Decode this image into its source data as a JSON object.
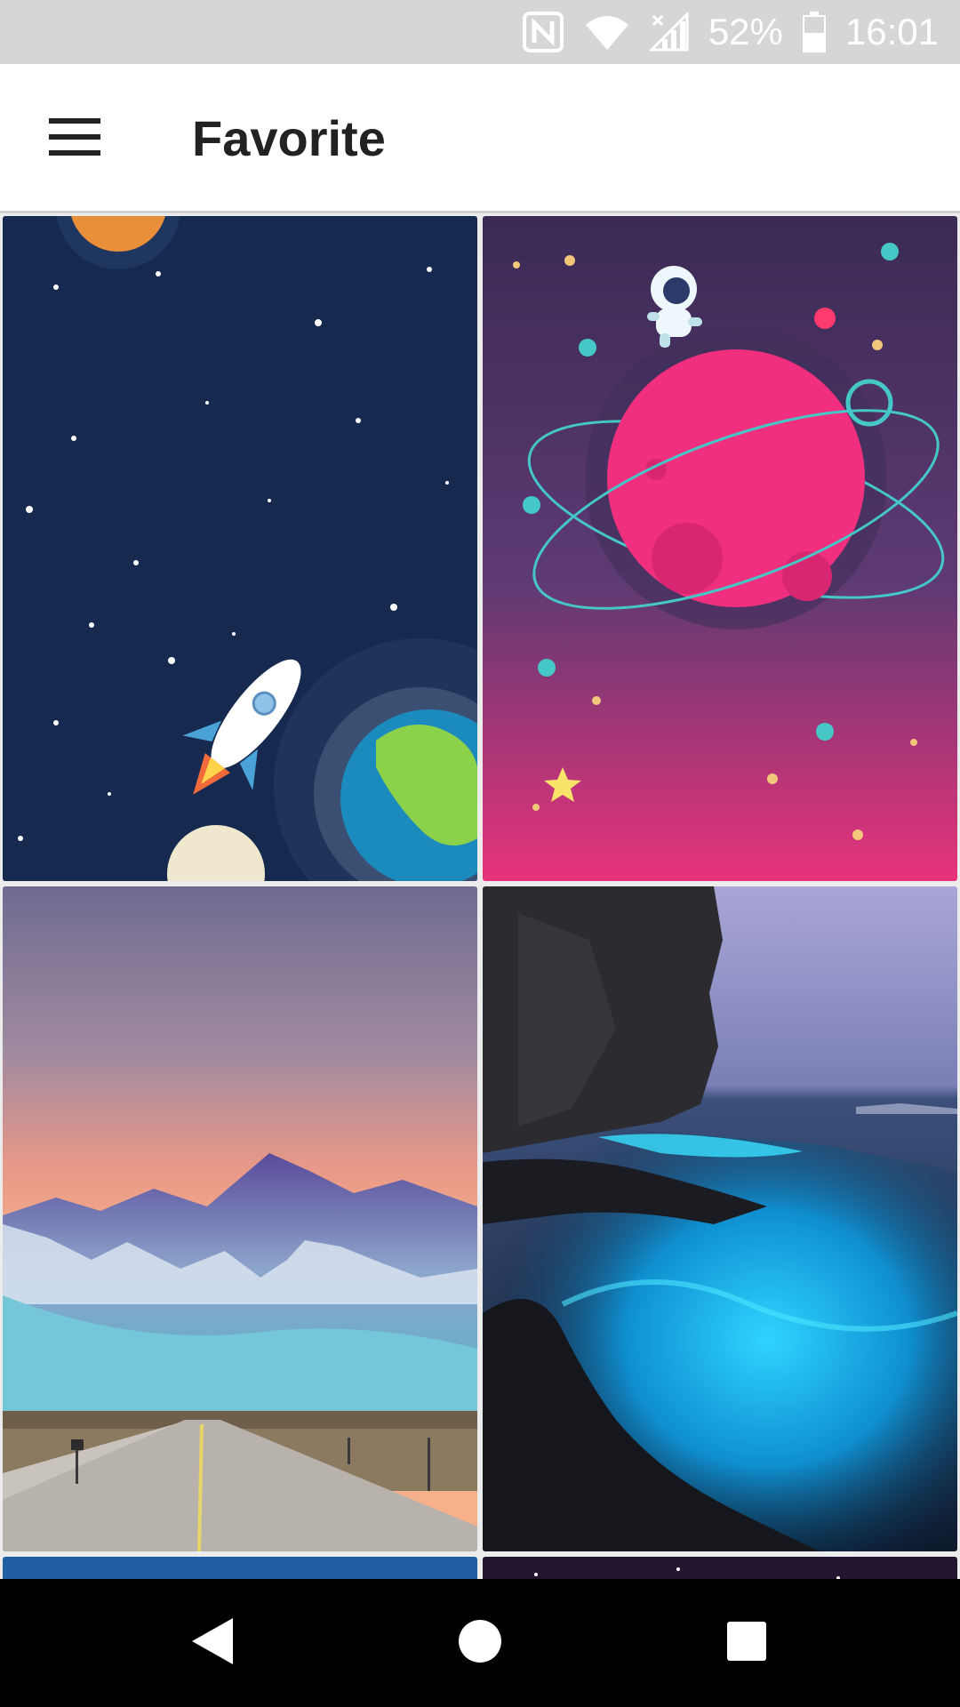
{
  "status_bar": {
    "battery": "52%",
    "time": "16:01",
    "icons": [
      "nfc-icon",
      "wifi-icon",
      "signal-icon",
      "battery-icon"
    ]
  },
  "app_bar": {
    "title": "Favorite",
    "menu_icon": "hamburger-menu-icon"
  },
  "wallpapers": [
    {
      "name": "wallpaper-rocket-space"
    },
    {
      "name": "wallpaper-astronaut-planet"
    },
    {
      "name": "wallpaper-mountain-road"
    },
    {
      "name": "wallpaper-glowing-sea-cliff"
    },
    {
      "name": "wallpaper-blue-partial"
    },
    {
      "name": "wallpaper-dark-partial"
    }
  ],
  "nav_bar": {
    "icons": [
      "back-icon",
      "home-icon",
      "recents-icon"
    ]
  },
  "colors": {
    "status_bar": "#d6d6d6",
    "app_bar": "#ffffff",
    "nav_bar": "#000000"
  }
}
